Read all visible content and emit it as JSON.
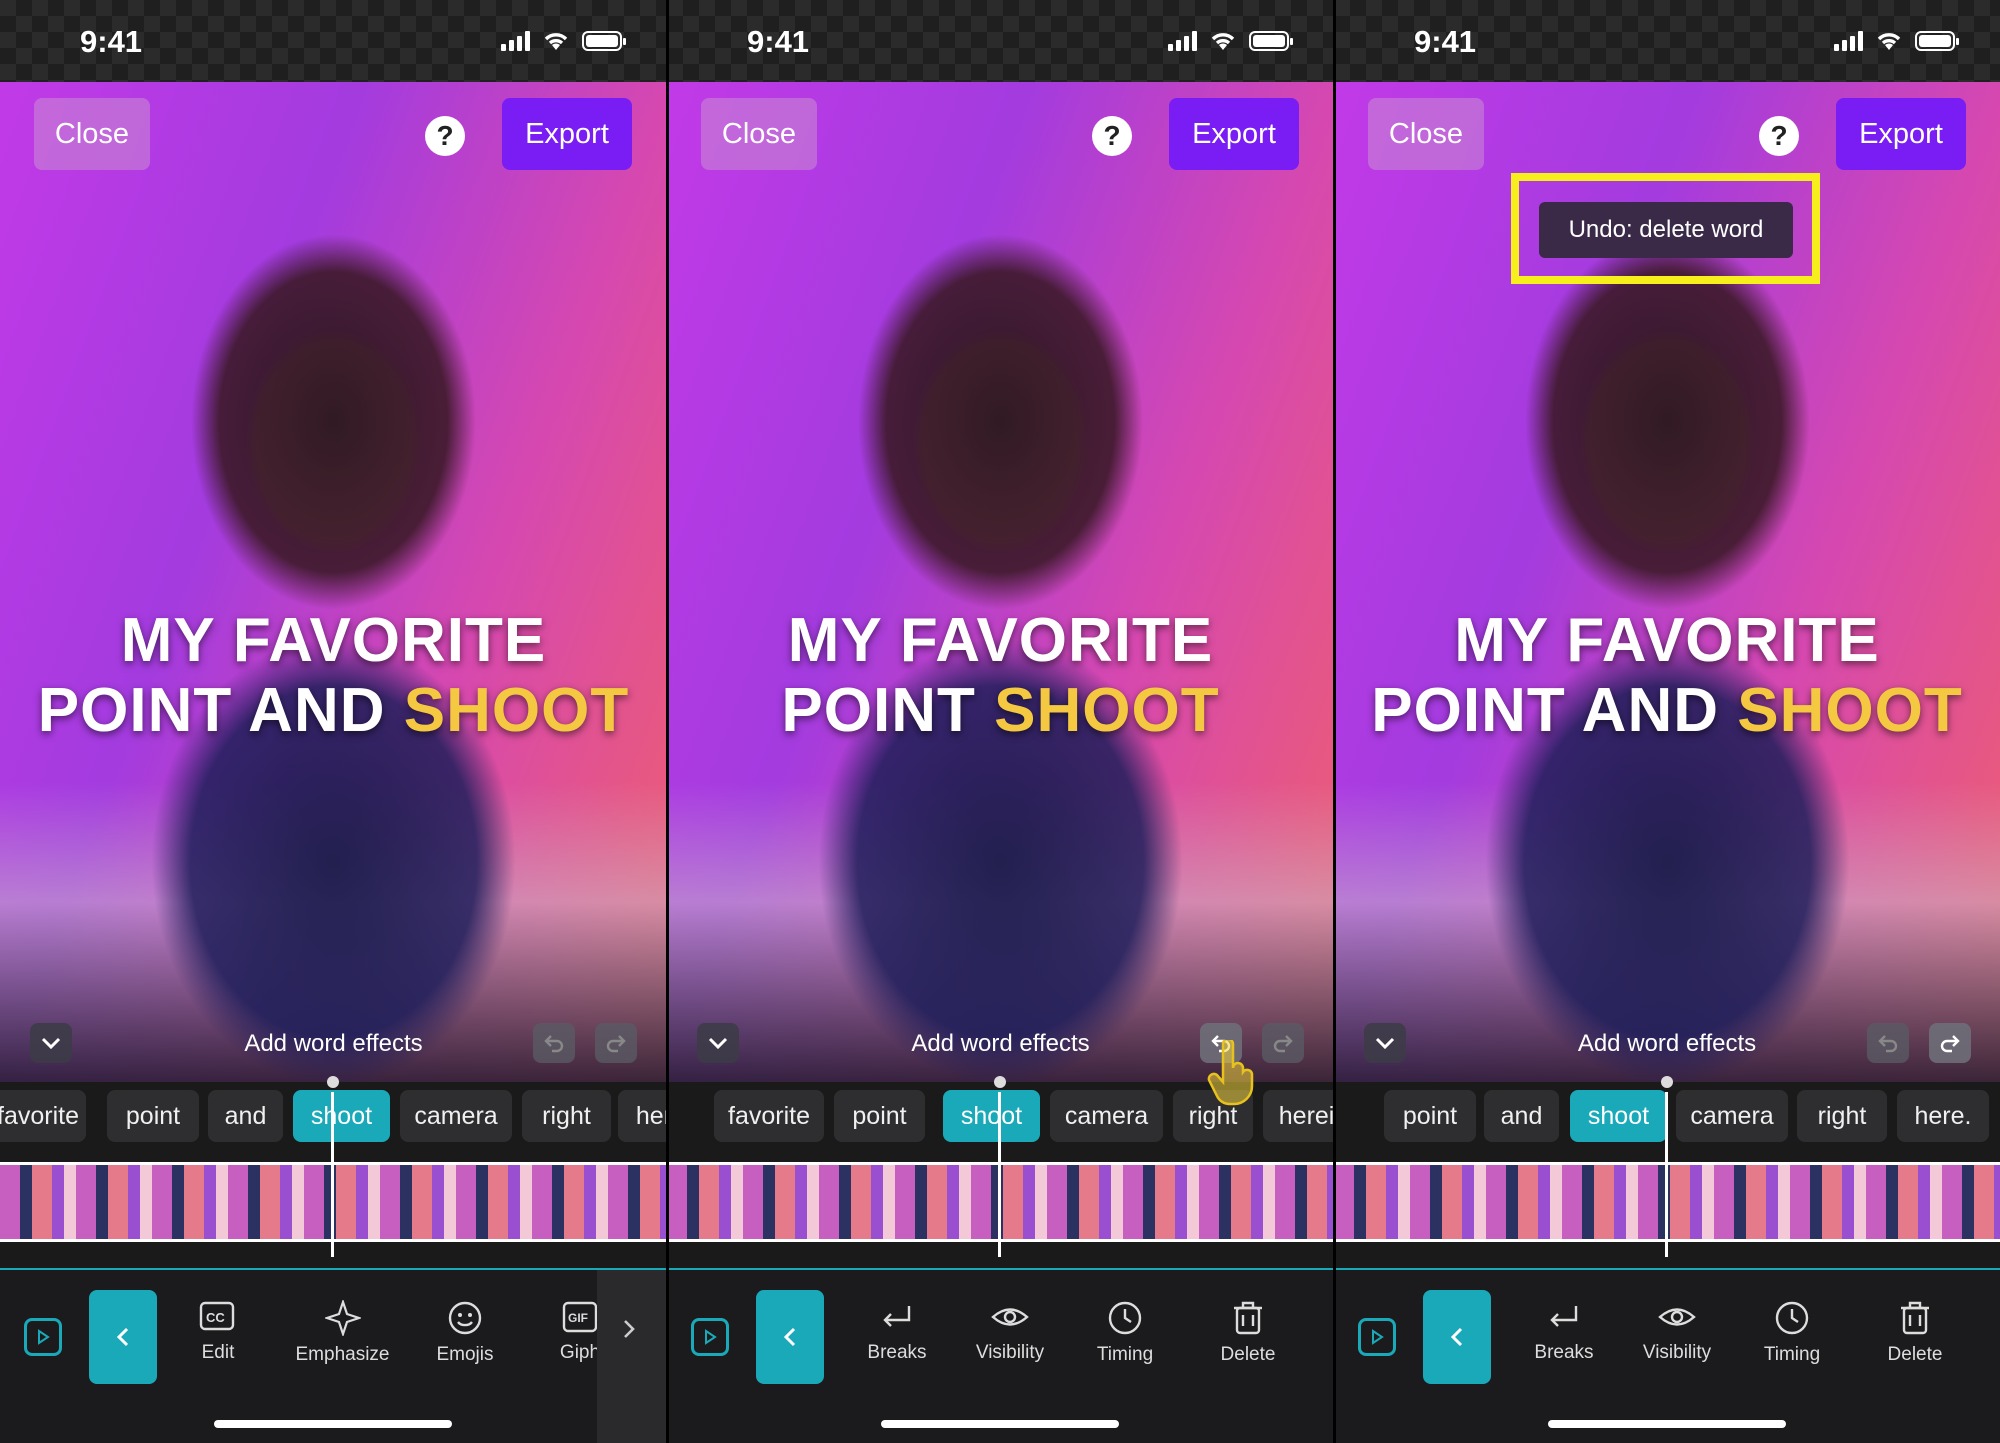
{
  "status": {
    "time": "9:41"
  },
  "header": {
    "close_label": "Close",
    "help_label": "?",
    "export_label": "Export"
  },
  "panels": [
    {
      "caption_line1": "MY FAVORITE",
      "caption_line2_plain": "POINT AND",
      "caption_line2_highlight": "SHOOT",
      "word_effects_label": "Add word effects",
      "words": [
        "favorite",
        "point",
        "and",
        "shoot",
        "camera",
        "right",
        "heny"
      ],
      "active_word": "shoot",
      "tools": [
        {
          "label": "Edit",
          "icon": "cc-edit-icon"
        },
        {
          "label": "Emphasize",
          "icon": "sparkle-icon"
        },
        {
          "label": "Emojis",
          "icon": "smile-icon"
        },
        {
          "label": "Giph",
          "icon": "gif-icon"
        }
      ]
    },
    {
      "caption_line1": "MY FAVORITE",
      "caption_line2_plain": "POINT",
      "caption_line2_highlight": "SHOOT",
      "word_effects_label": "Add word effects",
      "words": [
        "favorite",
        "point",
        "shoot",
        "camera",
        "right",
        "hereite"
      ],
      "active_word": "shoot",
      "tools": [
        {
          "label": "Breaks",
          "icon": "return-icon"
        },
        {
          "label": "Visibility",
          "icon": "eye-icon"
        },
        {
          "label": "Timing",
          "icon": "clock-icon"
        },
        {
          "label": "Delete",
          "icon": "trash-icon"
        }
      ]
    },
    {
      "caption_line1": "MY FAVORITE",
      "caption_line2_plain": "POINT AND",
      "caption_line2_highlight": "SHOOT",
      "word_effects_label": "Add word effects",
      "words": [
        "point",
        "and",
        "shoot",
        "camera",
        "right",
        "here."
      ],
      "active_word": "shoot",
      "toast": "Undo: delete word",
      "tools": [
        {
          "label": "Breaks",
          "icon": "return-icon"
        },
        {
          "label": "Visibility",
          "icon": "eye-icon"
        },
        {
          "label": "Timing",
          "icon": "clock-icon"
        },
        {
          "label": "Delete",
          "icon": "trash-icon"
        }
      ]
    }
  ],
  "colors": {
    "accent": "#1aa9b8",
    "export": "#7a1cf4",
    "highlight_word": "#f5c842",
    "callout": "#f7ef1b"
  }
}
